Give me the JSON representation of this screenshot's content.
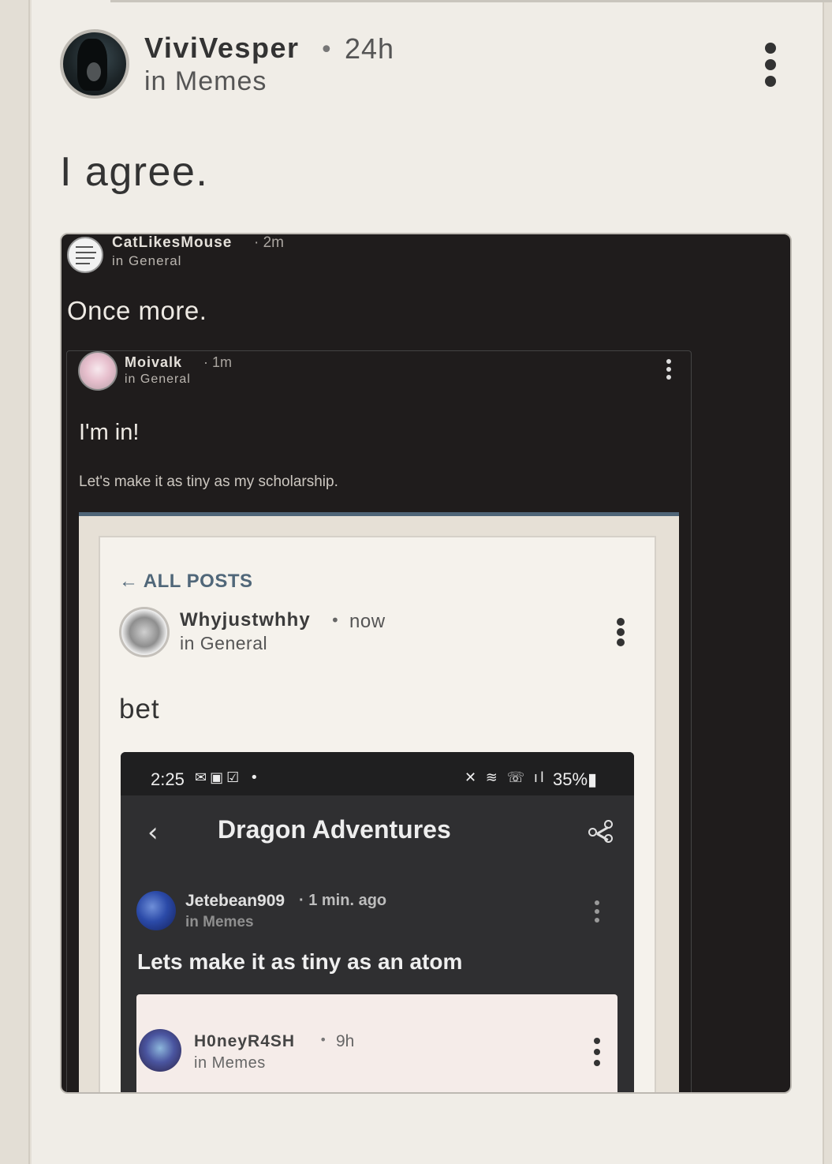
{
  "post": {
    "author": "ViviVesper",
    "time": "24h",
    "community": "in Memes",
    "text": "I agree."
  },
  "embed": {
    "author": "CatLikesMouse",
    "time": "2m",
    "community": "in General",
    "text": "Once more.",
    "quoted": {
      "author": "Moivalk",
      "time": "1m",
      "community": "in General",
      "text": "I'm in!",
      "description": "Let's make it as tiny as my scholarship.",
      "screenshot": {
        "back_label": "ALL POSTS",
        "author": "Whyjustwhhy",
        "time": "now",
        "community": "in General",
        "text": "bet",
        "phone": {
          "clock": "2:25",
          "battery": "35%",
          "title": "Dragon Adventures",
          "post": {
            "author": "Jetebean909",
            "time": "· 1 min. ago",
            "community": "in Memes",
            "text": "Lets make it as tiny as an atom"
          },
          "sub": {
            "author": "H0neyR4SH",
            "time": "9h",
            "community": "in Memes"
          }
        }
      }
    }
  },
  "colors": {
    "background": "#f0ede7",
    "dark": "#1f1c1c",
    "accent": "#506779"
  },
  "icons": [
    "more-vertical-icon",
    "arrow-left-icon",
    "chevron-left-icon",
    "share-icon",
    "mail-icon",
    "wifi-icon",
    "mute-icon",
    "battery-icon"
  ]
}
